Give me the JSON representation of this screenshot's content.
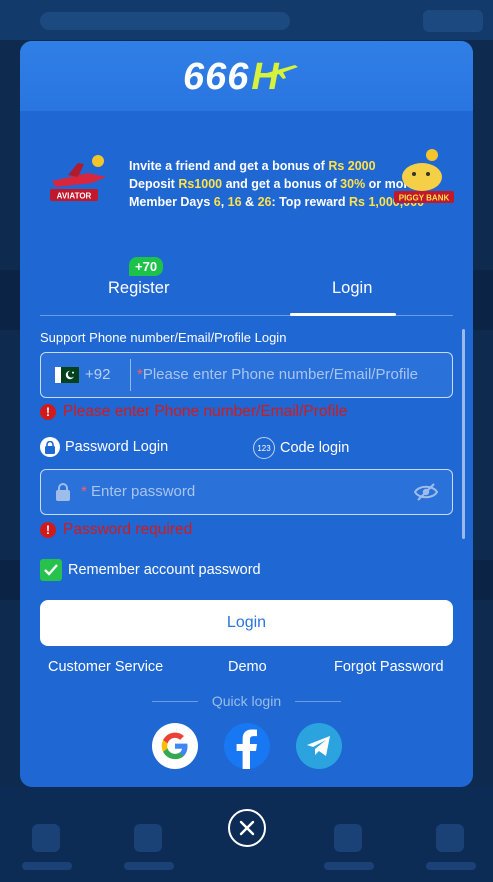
{
  "brand": {
    "logo_text": "666",
    "logo_h": "H"
  },
  "banner": {
    "aviator_label": "AVIATOR",
    "piggy_label": "PIGGY BANK",
    "line1_pre": "Invite a friend and get a bonus of ",
    "line1_amt": "Rs 2000",
    "line2_pre": "Deposit ",
    "line2_dep": "Rs1000",
    "line2_mid": " and get a bonus of ",
    "line2_pct": "30%",
    "line2_post": " or more",
    "line3_pre": "Member Days ",
    "line3_d1": "6",
    "line3_sep1": ", ",
    "line3_d2": "16",
    "line3_sep2": " & ",
    "line3_d3": "26",
    "line3_mid": ": Top reward ",
    "line3_amt": "Rs 1,000,000"
  },
  "tabs": {
    "register": "Register",
    "register_badge": "+70",
    "login": "Login",
    "active": "login"
  },
  "form": {
    "support_label": "Support Phone number/Email/Profile Login",
    "country_code": "+92",
    "required_mark": "*",
    "phone_placeholder": "Please enter Phone number/Email/Profile",
    "phone_error": "Please enter Phone number/Email/Profile",
    "password_login": "Password Login",
    "code_login": "Code login",
    "code_icon_text": "123",
    "password_placeholder": "Enter password",
    "password_error": "Password required",
    "remember_label": "Remember account password",
    "remember_checked": true,
    "login_button": "Login"
  },
  "links": {
    "customer_service": "Customer Service",
    "demo": "Demo",
    "forgot_password": "Forgot Password"
  },
  "quick_login": {
    "label": "Quick login",
    "providers": [
      "google-icon",
      "facebook-icon",
      "telegram-icon"
    ]
  },
  "colors": {
    "modal_bg": "#1f67d3",
    "error": "#d11b1b",
    "accent_green": "#27c24c",
    "highlight": "#ffe14a"
  }
}
